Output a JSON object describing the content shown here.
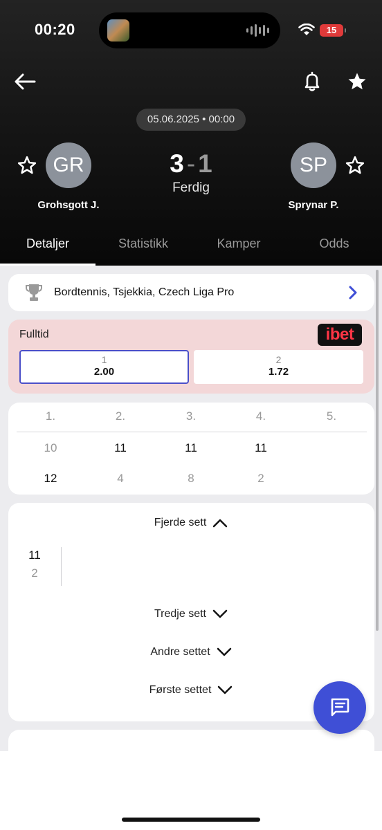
{
  "status_bar": {
    "time": "00:20",
    "battery": "15"
  },
  "match": {
    "date": "05.06.2025 • 00:00",
    "home": {
      "initials": "GR",
      "name": "Grohsgott J.",
      "score": "3"
    },
    "away": {
      "initials": "SP",
      "name": "Sprynar P.",
      "score": "1"
    },
    "separator": "-",
    "status": "Ferdig"
  },
  "tabs": [
    {
      "label": "Detaljer",
      "active": true
    },
    {
      "label": "Statistikk",
      "active": false
    },
    {
      "label": "Kamper",
      "active": false
    },
    {
      "label": "Odds",
      "active": false
    }
  ],
  "league": {
    "name": "Bordtennis, Tsjekkia, Czech Liga Pro"
  },
  "odds": {
    "title": "Fulltid",
    "bookmaker": "ibet",
    "options": [
      {
        "label": "1",
        "value": "2.00",
        "selected": true
      },
      {
        "label": "2",
        "value": "1.72",
        "selected": false
      }
    ]
  },
  "sets": {
    "headers": [
      "1.",
      "2.",
      "3.",
      "4.",
      "5."
    ],
    "home": [
      "10",
      "11",
      "11",
      "11",
      ""
    ],
    "away": [
      "12",
      "4",
      "8",
      "2",
      ""
    ]
  },
  "set_details": {
    "expanded": {
      "title": "Fjerde sett",
      "home_points": "11",
      "away_points": "2"
    },
    "collapsed": [
      "Tredje sett",
      "Andre settet",
      "Første settet"
    ]
  },
  "icons": {
    "back": "arrow-left-icon",
    "bell": "bell-icon",
    "favorite": "star-icon",
    "trophy": "trophy-icon",
    "chevron": "chevron-right-icon",
    "chat": "chat-icon"
  },
  "colors": {
    "accent": "#3f4fd6",
    "ibet": "#ff3545",
    "odds_bg": "#f3d7d8"
  }
}
